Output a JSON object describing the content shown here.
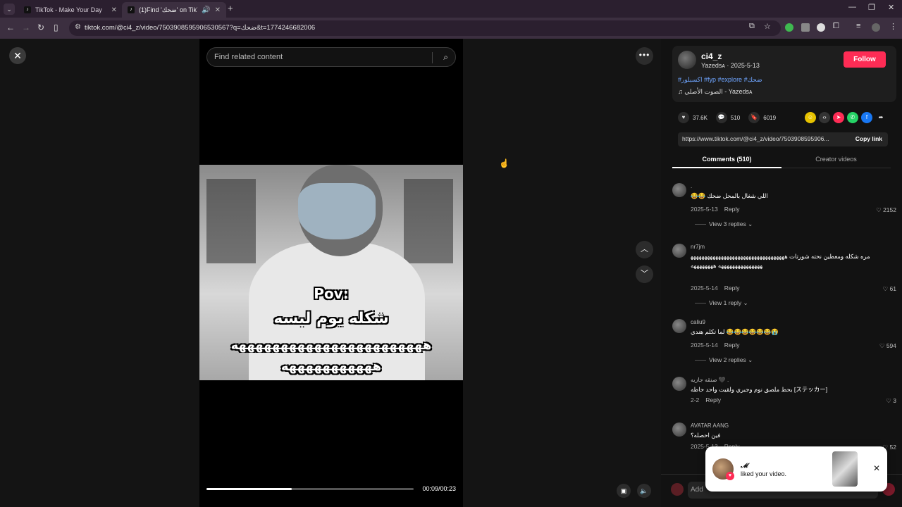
{
  "browser": {
    "tabs": [
      {
        "label": "TikTok - Make Your Day"
      },
      {
        "label": "(1)Find 'ضحك' on TikTok | T"
      }
    ],
    "url": "tiktok.com/@ci4_z/video/7503908595906530567?q=ضحك&t=1774246682006"
  },
  "player": {
    "search_placeholder": "Find related content",
    "overlay_text": [
      "Pov:",
      "شكله يوم لبسه",
      "هههههههههههههههههههههههه",
      "هههههههههههه"
    ],
    "progress": 0.41,
    "time": "00:09/00:23"
  },
  "creator": {
    "username": "ci4_z",
    "meta": "Yazedsᴀ · 2025-5-13",
    "follow_label": "Follow",
    "tags": "#اكسبلور #fyp #explore #ضحك",
    "music": "♫  الصوت الأصلي - Yazedsᴀ"
  },
  "stats": {
    "likes": "37.6K",
    "comments": "510",
    "saves": "6019"
  },
  "link": {
    "url": "https://www.tiktok.com/@ci4_z/video/7503908595906...",
    "copy_label": "Copy link"
  },
  "tabs": {
    "comments": "Comments (510)",
    "creator_videos": "Creator videos"
  },
  "comments": [
    {
      "name": ".",
      "text": "اللي شغال بالمحل ضحك 😂😂",
      "date": "2025-5-13",
      "reply": "Reply",
      "likes": "2152",
      "replies": "View 3 replies"
    },
    {
      "name": "nr7jm",
      "text": "مره شكله ومعطين نحته شورتات ههههههههههههههههههههههههههههههههههههههههههههههههههه ههههههههه",
      "date": "2025-5-14",
      "reply": "Reply",
      "likes": "61",
      "replies": "View 1 reply"
    },
    {
      "name": "caliu9",
      "text": "لما تكلم هندي 😂😂😂😂😂😂😭",
      "date": "2025-5-14",
      "reply": "Reply",
      "likes": "594",
      "replies": "View 2 replies"
    },
    {
      "name": "صنقه جازيه 🖤 .",
      "text": "بحط ملصق نوم وجبري ولقيت واحد حاطه [ステッカー]",
      "date": "2-2",
      "reply": "Reply",
      "likes": "3",
      "replies": ""
    },
    {
      "name": "AVATAR AANG",
      "text": "فين احصله؟",
      "date": "2025-5-13",
      "reply": "Reply",
      "likes": "52",
      "replies": ""
    }
  ],
  "add_comment_placeholder": "Add",
  "notification": {
    "name": "𝓜",
    "message": "liked your video."
  }
}
